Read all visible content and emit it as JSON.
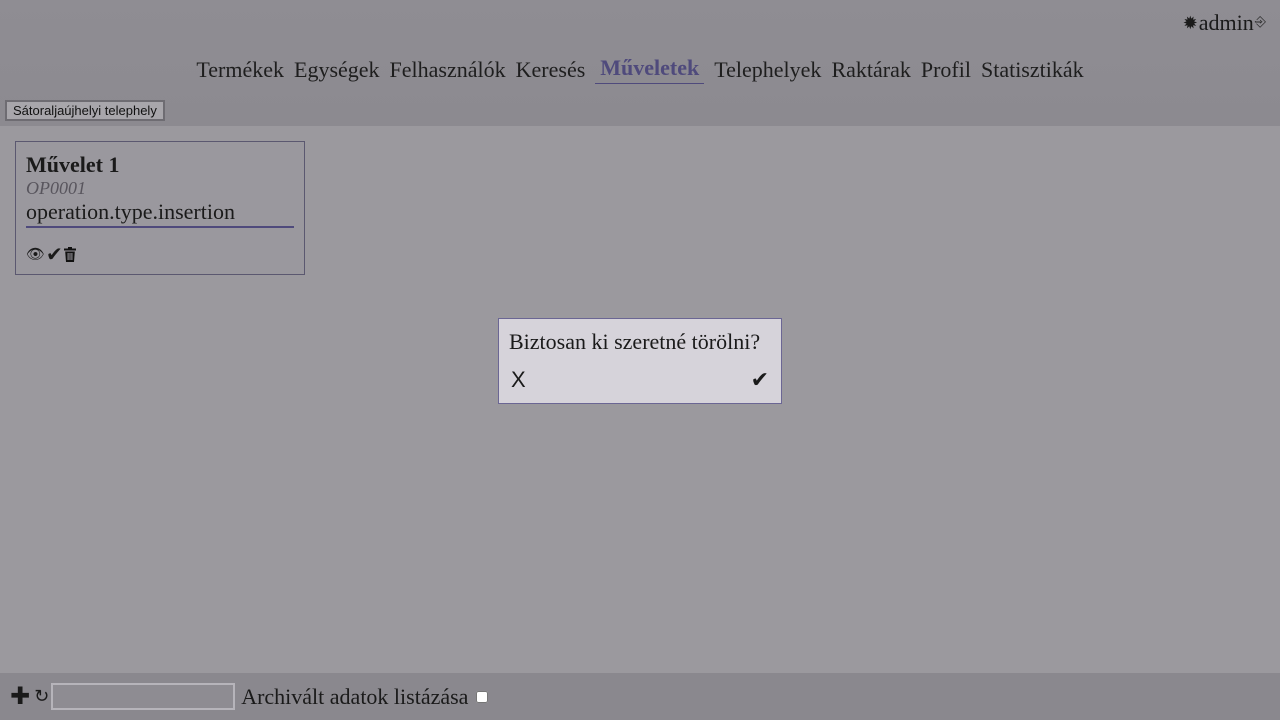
{
  "header": {
    "user_icon": "sun-icon",
    "username": "admin",
    "logout_icon": "logout-icon",
    "nav": [
      {
        "label": "Termékek",
        "active": false
      },
      {
        "label": "Egységek",
        "active": false
      },
      {
        "label": "Felhasználók",
        "active": false
      },
      {
        "label": "Keresés",
        "active": false
      },
      {
        "label": "Műveletek",
        "active": true
      },
      {
        "label": "Telephelyek",
        "active": false
      },
      {
        "label": "Raktárak",
        "active": false
      },
      {
        "label": "Profil",
        "active": false
      },
      {
        "label": "Statisztikák",
        "active": false
      }
    ],
    "site_button_label": "Sátoraljaújhelyi telephely"
  },
  "operation_card": {
    "title": "Művelet 1",
    "code": "OP0001",
    "type": "operation.type.insertion",
    "actions": {
      "view_icon": "eye-icon",
      "approve_icon": "check-icon",
      "delete_icon": "trash-icon"
    }
  },
  "dialog": {
    "question": "Biztosan ki szeretné törölni?",
    "cancel_label": "X",
    "confirm_icon": "check-icon"
  },
  "footer": {
    "add_icon": "plus-icon",
    "refresh_icon": "refresh-icon",
    "search_value": "",
    "archived_label": "Archivált adatok listázása",
    "archived_checked": false
  },
  "colors": {
    "accent": "#4f4a7c",
    "background": "#9b999e",
    "dialog_bg": "#d6d3da"
  }
}
